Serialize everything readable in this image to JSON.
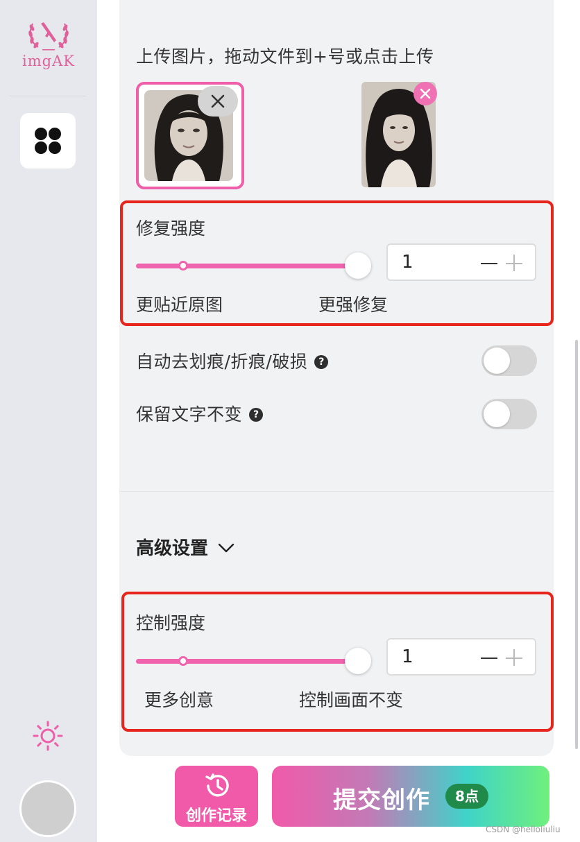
{
  "sidebar": {
    "logo_text": "imgAK",
    "app_button_icon": "apps-grid-icon",
    "theme_icon": "sun-icon",
    "avatar_icon": "user-avatar"
  },
  "upload": {
    "label": "上传图片，拖动文件到+号或点击上传",
    "images": [
      {
        "selected": true,
        "remove_icon": "close-icon"
      },
      {
        "selected": false,
        "remove_icon": "close-circle-icon"
      }
    ]
  },
  "repair_strength": {
    "title": "修复强度",
    "value": "1",
    "slider_fraction": 1.0,
    "left_label": "更贴近原图",
    "right_label": "更强修复"
  },
  "options": {
    "auto_scratch": {
      "label": "自动去划痕/折痕/破损",
      "help": "?",
      "enabled": false
    },
    "keep_text": {
      "label": "保留文字不变",
      "help": "?",
      "enabled": false
    }
  },
  "advanced": {
    "label": "高级设置",
    "icon": "chevron-down-icon"
  },
  "control_strength": {
    "title": "控制强度",
    "value": "1",
    "slider_fraction": 1.0,
    "left_label": "更多创意",
    "right_label": "控制画面不变"
  },
  "actions": {
    "history_label": "创作记录",
    "history_icon": "history-icon",
    "submit_label": "提交创作",
    "submit_cost": "8点"
  },
  "colors": {
    "accent": "#ef5ea8",
    "highlight_box": "#e8251d",
    "badge": "#1f8a4a"
  },
  "watermark": "CSDN @helloliuliu"
}
